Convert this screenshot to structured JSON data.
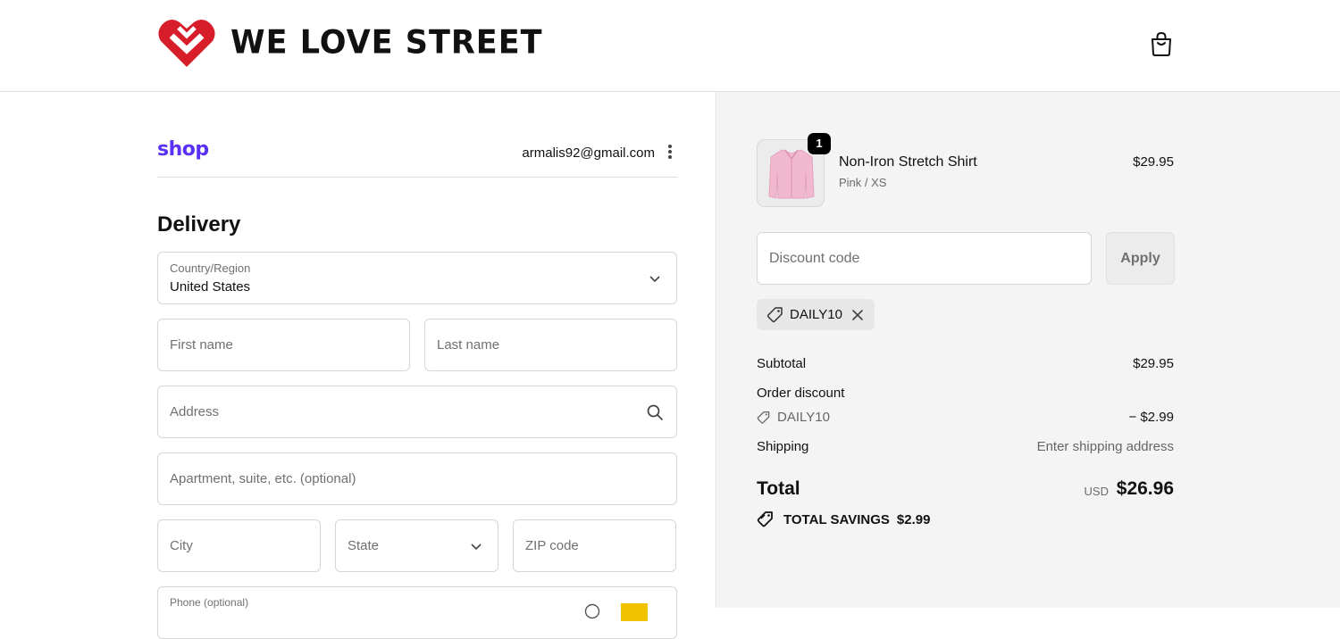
{
  "header": {
    "brand_we": "WE",
    "brand_love": "LOVE",
    "brand_street": "STREET",
    "brand_color": "#d71d2a"
  },
  "account": {
    "shop_label": "shop",
    "email": "armalis92@gmail.com"
  },
  "delivery": {
    "title": "Delivery",
    "country_label": "Country/Region",
    "country_value": "United States",
    "first_name_placeholder": "First name",
    "last_name_placeholder": "Last name",
    "address_placeholder": "Address",
    "apartment_placeholder": "Apartment, suite, etc. (optional)",
    "city_placeholder": "City",
    "state_placeholder": "State",
    "zip_placeholder": "ZIP code",
    "phone_label": "Phone (optional)"
  },
  "summary": {
    "item": {
      "quantity": "1",
      "name": "Non-Iron Stretch Shirt",
      "variant": "Pink / XS",
      "price": "$29.95"
    },
    "discount_placeholder": "Discount code",
    "apply_label": "Apply",
    "applied_code": "DAILY10",
    "subtotal_label": "Subtotal",
    "subtotal_value": "$29.95",
    "order_discount_label": "Order discount",
    "order_discount_code": "DAILY10",
    "order_discount_value": "− $2.99",
    "shipping_label": "Shipping",
    "shipping_value": "Enter shipping address",
    "total_label": "Total",
    "total_currency": "USD",
    "total_value": "$26.96",
    "savings_label": "TOTAL SAVINGS",
    "savings_value": "$2.99"
  },
  "colors": {
    "shop_purple": "#5a31f4",
    "panel_bg": "#f4f4f4",
    "product_pink": "#f2b8cf"
  }
}
